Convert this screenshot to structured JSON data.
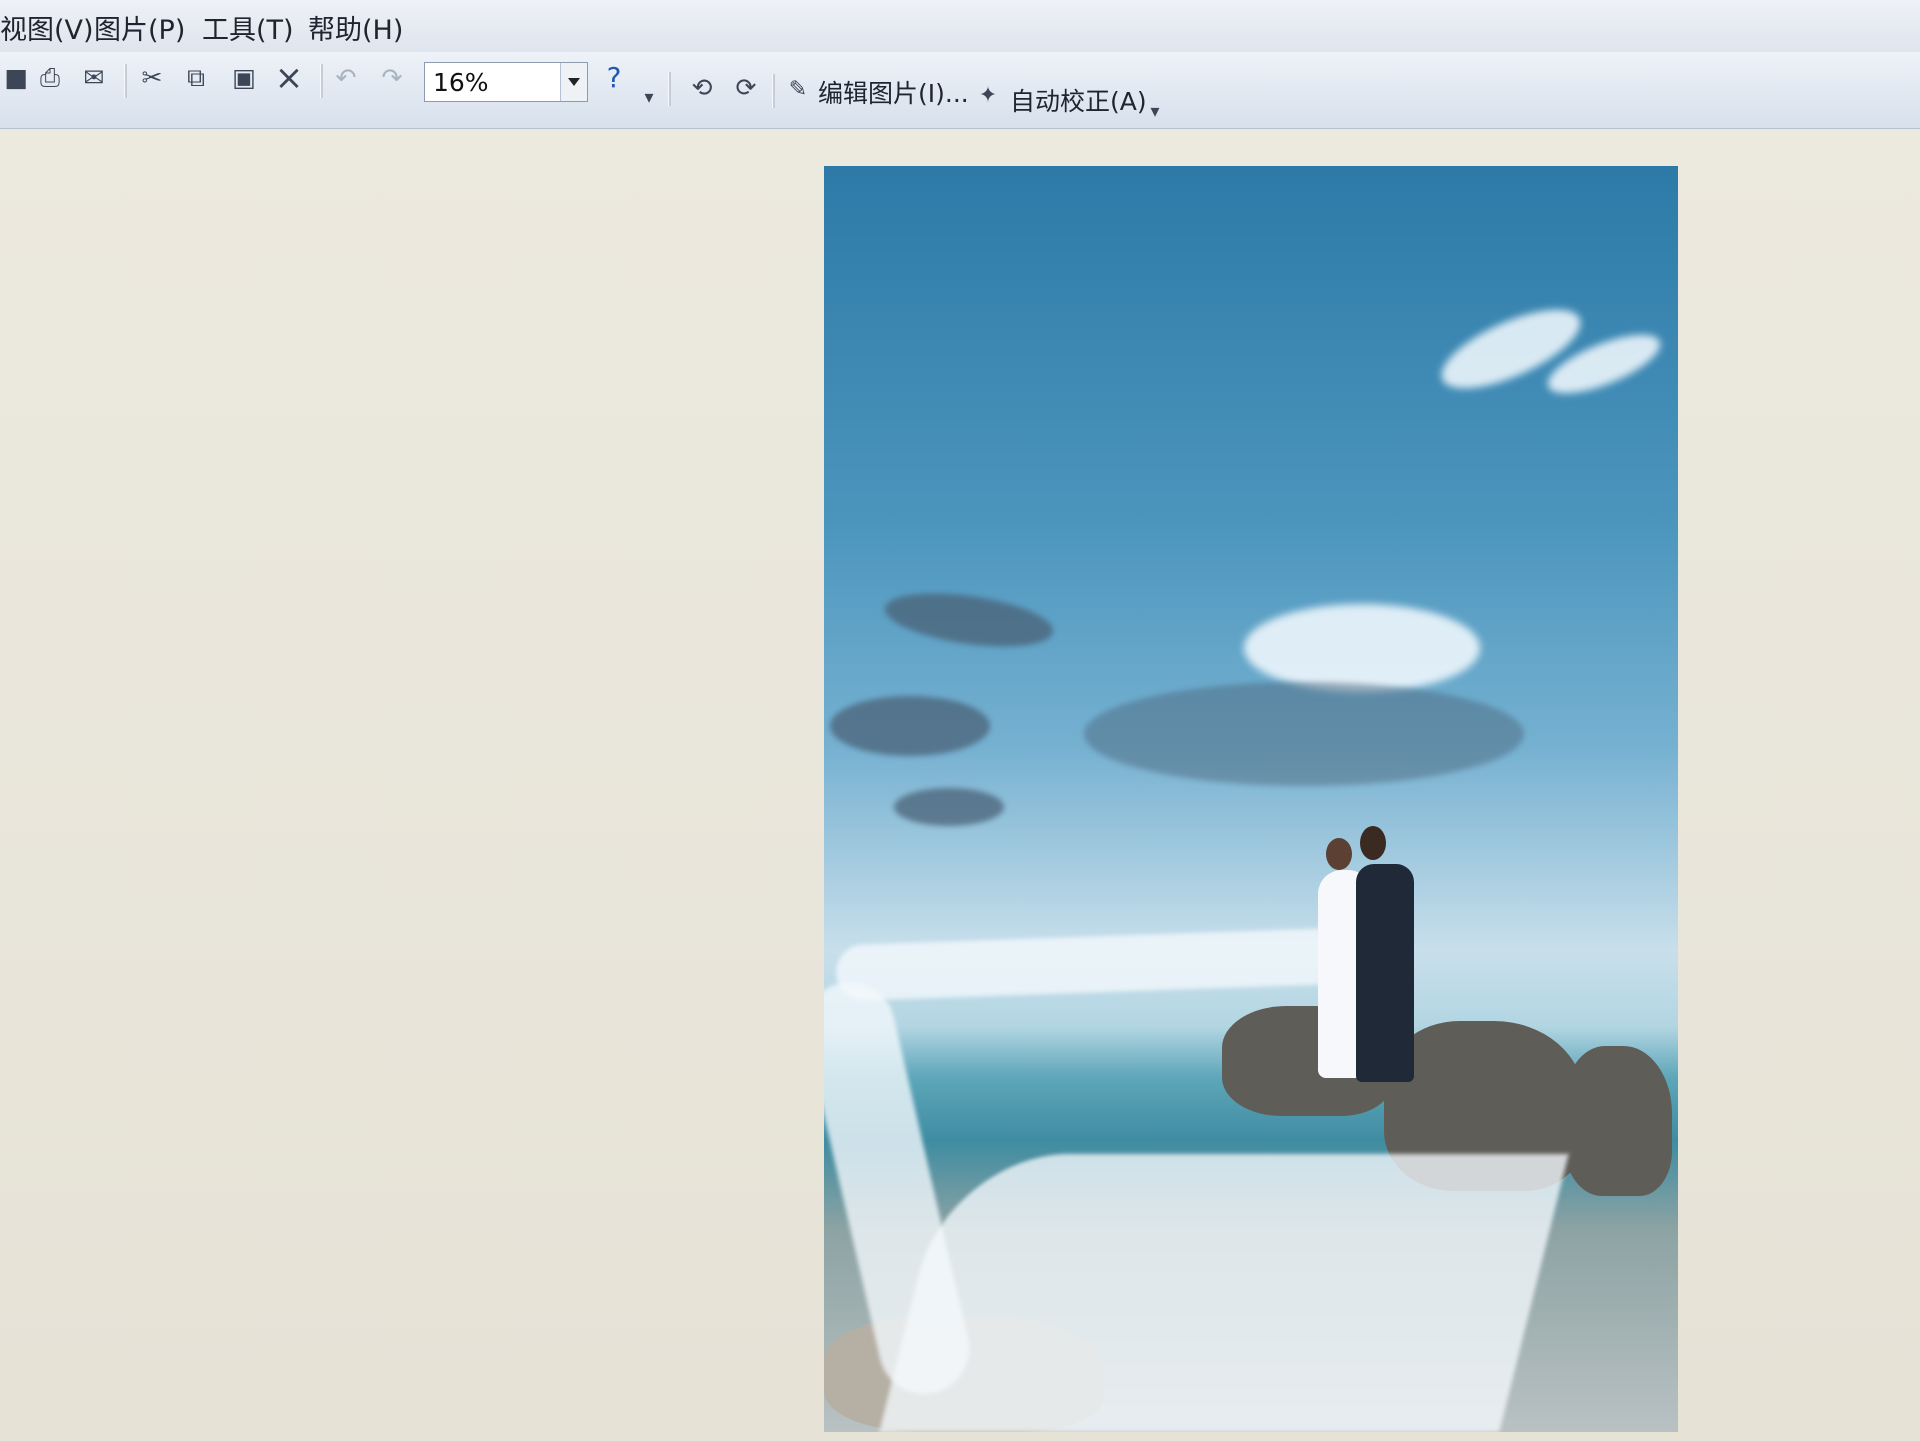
{
  "menu": [
    "视图(V)",
    "图片(P)",
    "工具(T)",
    "帮助(H)"
  ],
  "toolbar": {
    "zoom": "16%",
    "edit_picture": "编辑图片(I)...",
    "auto_correct": "自动校正(A)"
  },
  "icons": {
    "save": "save-icon",
    "print": "print-icon",
    "email": "email-icon",
    "cut": "cut-icon",
    "copy": "copy-icon",
    "paste": "paste-icon",
    "delete": "delete-icon",
    "undo": "undo-icon",
    "redo": "redo-icon",
    "help": "help-icon",
    "rotate_left": "rotate-left-icon",
    "rotate_right": "rotate-right-icon",
    "edit": "edit-picture-icon",
    "auto_fix": "auto-correct-icon"
  }
}
